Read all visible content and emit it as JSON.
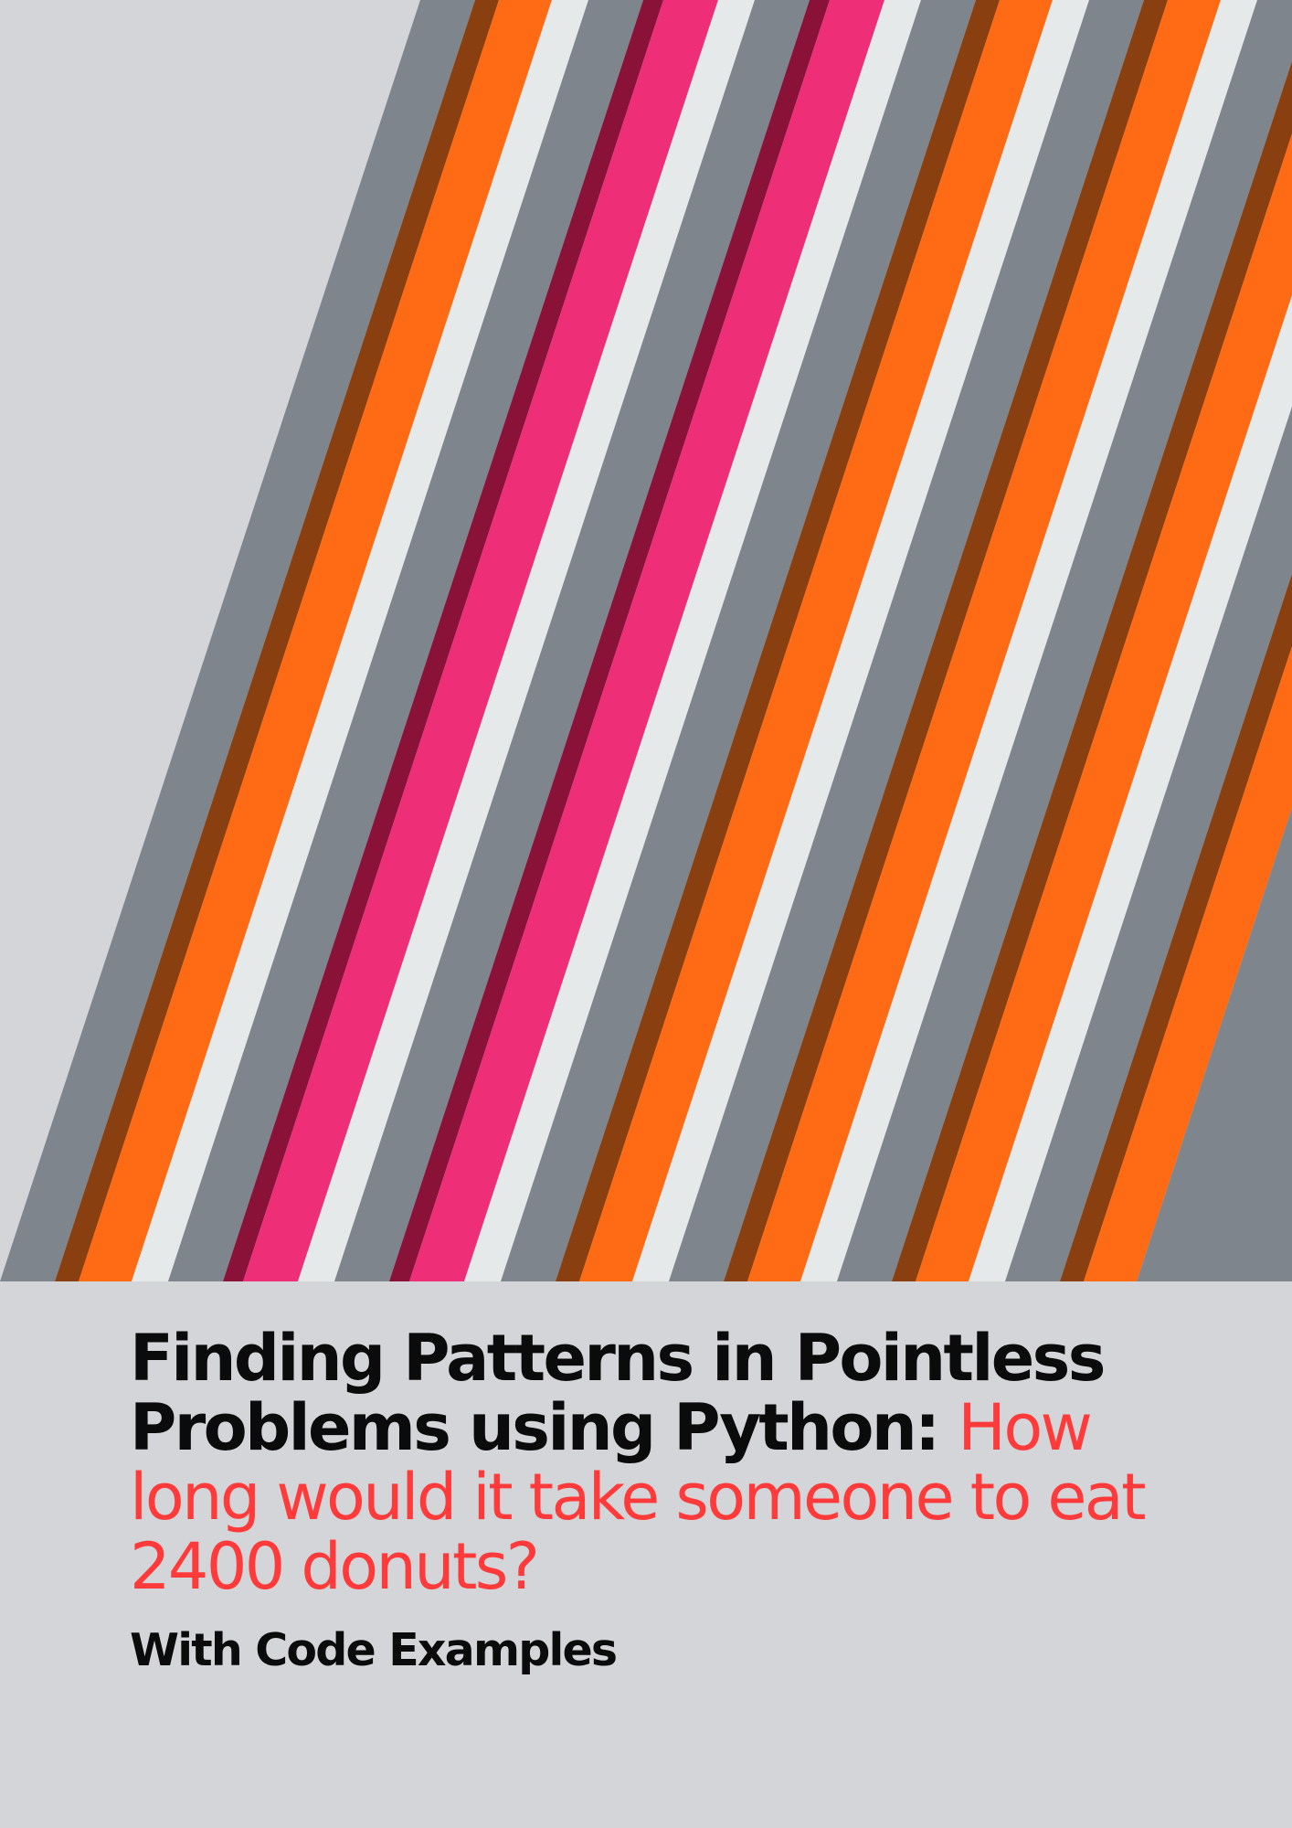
{
  "cover": {
    "title_main": "Finding Patterns in Pointless Problems using Python: ",
    "title_accent": "How long would it take someone to eat 2400 donuts?",
    "subtitle": "With Code Examples"
  },
  "artwork": {
    "background": "#d4d5d8",
    "stripe_colors": {
      "gray": "#7f858d",
      "brown": "#8a3f10",
      "orange": "#ff6a14",
      "white": "#e6e9ea",
      "maroon": "#8a1238",
      "pink": "#ee2f78"
    },
    "stripe_sequence": [
      "gray",
      "brown",
      "orange",
      "white",
      "gray",
      "maroon",
      "pink",
      "white",
      "gray",
      "maroon",
      "pink",
      "white",
      "gray",
      "brown",
      "orange",
      "white",
      "gray",
      "brown",
      "orange",
      "white",
      "gray",
      "brown",
      "orange",
      "white",
      "gray",
      "brown",
      "orange"
    ]
  },
  "colors": {
    "title_text": "#0b0b0b",
    "accent_text": "#ff3a3a"
  }
}
